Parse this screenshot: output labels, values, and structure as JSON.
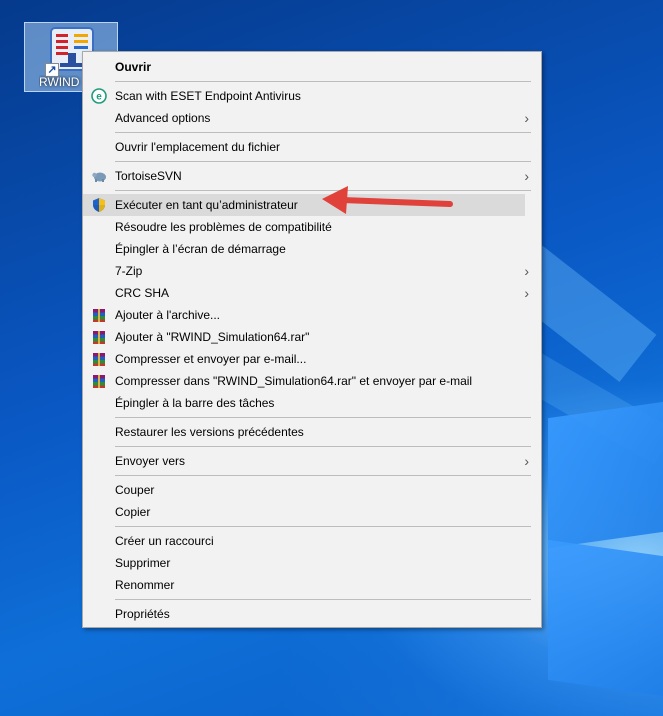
{
  "desktop": {
    "icon_label": "RWIND",
    "icon_name": "rwind-app-icon"
  },
  "menu": {
    "items": [
      {
        "label": "Ouvrir",
        "bold": true,
        "icon": null,
        "submenu": false
      },
      {
        "sep": true
      },
      {
        "label": "Scan with ESET Endpoint Antivirus",
        "icon": "eset-icon",
        "submenu": false
      },
      {
        "label": "Advanced options",
        "icon": null,
        "submenu": true
      },
      {
        "sep": true
      },
      {
        "label": "Ouvrir l'emplacement du fichier",
        "icon": null,
        "submenu": false
      },
      {
        "sep": true
      },
      {
        "label": "TortoiseSVN",
        "icon": "tortoisesvn-icon",
        "submenu": true
      },
      {
        "sep": true
      },
      {
        "label": "Exécuter en tant qu’administrateur",
        "icon": "uac-shield-icon",
        "submenu": false,
        "highlighted": true
      },
      {
        "label": "Résoudre les problèmes de compatibilité",
        "icon": null,
        "submenu": false
      },
      {
        "label": "Épingler à l’écran de démarrage",
        "icon": null,
        "submenu": false
      },
      {
        "label": "7-Zip",
        "icon": null,
        "submenu": true
      },
      {
        "label": "CRC SHA",
        "icon": null,
        "submenu": true
      },
      {
        "label": "Ajouter à l'archive...",
        "icon": "winrar-icon",
        "submenu": false
      },
      {
        "label": "Ajouter à \"RWIND_Simulation64.rar\"",
        "icon": "winrar-icon",
        "submenu": false
      },
      {
        "label": "Compresser et envoyer par e-mail...",
        "icon": "winrar-icon",
        "submenu": false
      },
      {
        "label": "Compresser dans \"RWIND_Simulation64.rar\" et envoyer par e-mail",
        "icon": "winrar-icon",
        "submenu": false
      },
      {
        "label": "Épingler à la barre des tâches",
        "icon": null,
        "submenu": false
      },
      {
        "sep": true
      },
      {
        "label": "Restaurer les versions précédentes",
        "icon": null,
        "submenu": false
      },
      {
        "sep": true
      },
      {
        "label": "Envoyer vers",
        "icon": null,
        "submenu": true
      },
      {
        "sep": true
      },
      {
        "label": "Couper",
        "icon": null,
        "submenu": false
      },
      {
        "label": "Copier",
        "icon": null,
        "submenu": false
      },
      {
        "sep": true
      },
      {
        "label": "Créer un raccourci",
        "icon": null,
        "submenu": false
      },
      {
        "label": "Supprimer",
        "icon": null,
        "submenu": false
      },
      {
        "label": "Renommer",
        "icon": null,
        "submenu": false
      },
      {
        "sep": true
      },
      {
        "label": "Propriétés",
        "icon": null,
        "submenu": false
      }
    ]
  },
  "annotation": {
    "arrow_color": "#e0413a",
    "points_to": "Exécuter en tant qu’administrateur"
  },
  "colors": {
    "menu_bg": "#f2f2f2",
    "highlight_bg": "#dadada",
    "desktop_blue": "#0b5fc2"
  }
}
